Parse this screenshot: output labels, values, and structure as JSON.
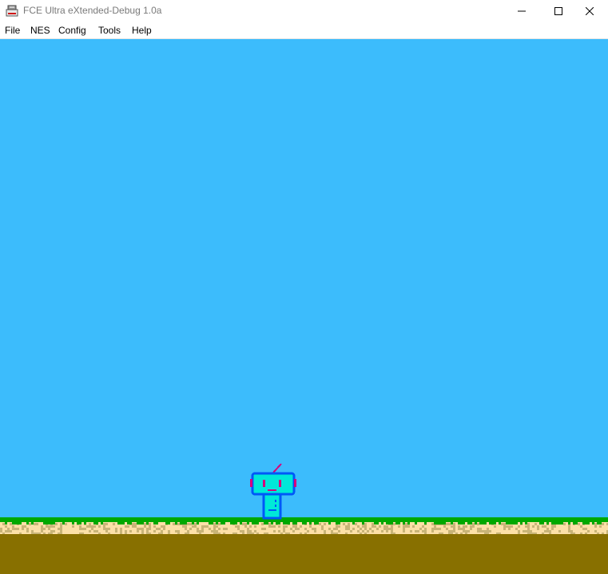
{
  "window": {
    "title": "FCE Ultra eXtended-Debug 1.0a",
    "icon": "nes-console-icon"
  },
  "menu": {
    "items": [
      {
        "label": "File"
      },
      {
        "label": "NES"
      },
      {
        "label": "Config"
      },
      {
        "label": "Tools"
      },
      {
        "label": "Help"
      }
    ]
  },
  "game": {
    "sky_color": "#3cbcfc",
    "grass_color": "#00a800",
    "sand_color": "#fce0a8",
    "sand_shade_color": "#c8b478",
    "dirt_color": "#887000",
    "robot": {
      "body_color": "#00e8d8",
      "outline_color": "#0058f8",
      "accent_color": "#d8007c"
    }
  }
}
